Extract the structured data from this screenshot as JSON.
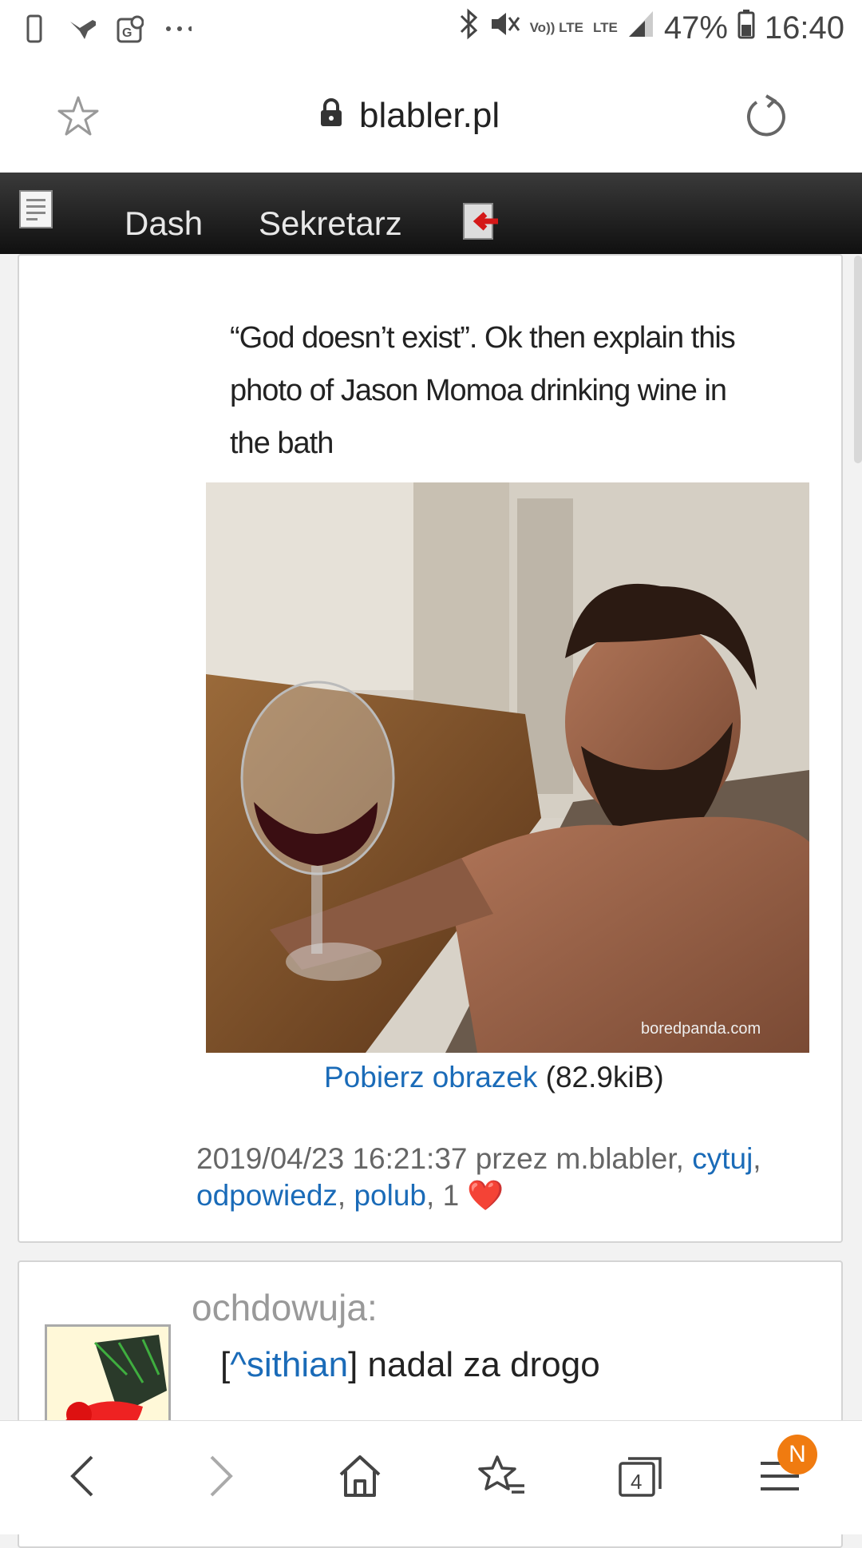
{
  "status_bar": {
    "icons_left": [
      "phone-outline-icon",
      "bird-icon",
      "maps-icon",
      "more-dots-icon"
    ],
    "network": "LTE",
    "volte": "Vo)) LTE",
    "battery": "47%",
    "time": "16:40"
  },
  "browser": {
    "url": "blabler.pl"
  },
  "site_nav": {
    "items": [
      {
        "label": "Dash"
      },
      {
        "label": "Sekretarz"
      }
    ]
  },
  "post": {
    "caption": "“God doesn’t exist”. Ok then explain this photo of Jason Momoa drinking wine in the bath",
    "watermark": "boredpanda.com",
    "download_label": "Pobierz obrazek",
    "download_size": "(82.9kiB)",
    "meta_text": "2019/04/23 16:21:37 przez m.blabler,",
    "cite_label": "cytuj",
    "reply_label": "odpowiedz",
    "like_label": "polub",
    "likes_count": "1",
    "heart": "❤️"
  },
  "comment": {
    "author": "ochdowuja:",
    "mention": "^sithian",
    "text": "nadal za drogo"
  },
  "bottom_nav": {
    "tabs_count": "4",
    "badge": "N"
  },
  "colors": {
    "link": "#1a6bb8",
    "nav_bg": "#1a1a1a",
    "badge": "#f07b10"
  }
}
